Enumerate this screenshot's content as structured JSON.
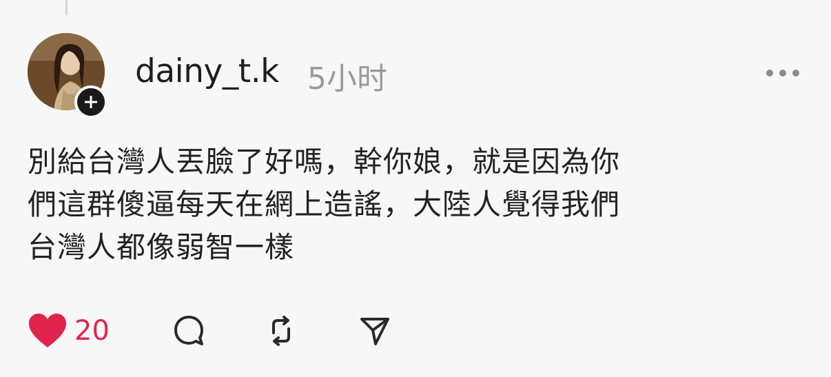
{
  "post": {
    "username": "dainy_t.k",
    "timestamp": "5小时",
    "text_lines": [
      "別給台灣人丟臉了好嗎，幹你娘，就是因為你",
      "們這群傻逼每天在網上造謠，大陸人覺得我們",
      "台灣人都像弱智一樣"
    ],
    "like_count": "20"
  },
  "icons": {
    "follow": "plus-icon",
    "more": "more-icon",
    "like": "heart-icon",
    "reply": "comment-icon",
    "repost": "repost-icon",
    "share": "send-icon"
  },
  "colors": {
    "like": "#e0244b",
    "muted": "#9a9a9a",
    "text": "#222222"
  }
}
